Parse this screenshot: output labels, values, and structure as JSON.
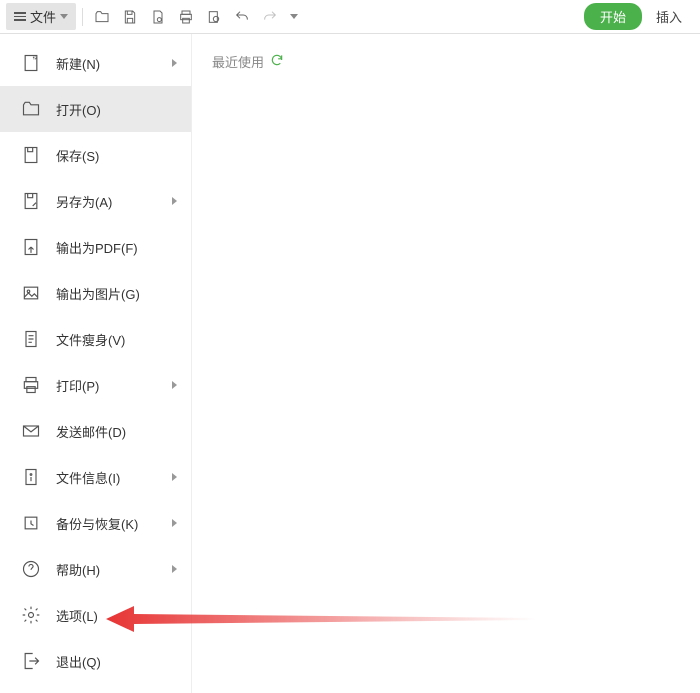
{
  "toolbar": {
    "file_label": "文件"
  },
  "tabs": {
    "start": "开始",
    "insert": "插入"
  },
  "menu": {
    "items": [
      {
        "label": "新建(N)",
        "submenu": true
      },
      {
        "label": "打开(O)",
        "submenu": false
      },
      {
        "label": "保存(S)",
        "submenu": false
      },
      {
        "label": "另存为(A)",
        "submenu": true
      },
      {
        "label": "输出为PDF(F)",
        "submenu": false
      },
      {
        "label": "输出为图片(G)",
        "submenu": false
      },
      {
        "label": "文件瘦身(V)",
        "submenu": false
      },
      {
        "label": "打印(P)",
        "submenu": true
      },
      {
        "label": "发送邮件(D)",
        "submenu": false
      },
      {
        "label": "文件信息(I)",
        "submenu": true
      },
      {
        "label": "备份与恢复(K)",
        "submenu": true
      },
      {
        "label": "帮助(H)",
        "submenu": true
      },
      {
        "label": "选项(L)",
        "submenu": false
      },
      {
        "label": "退出(Q)",
        "submenu": false
      }
    ]
  },
  "content": {
    "recent_label": "最近使用"
  }
}
